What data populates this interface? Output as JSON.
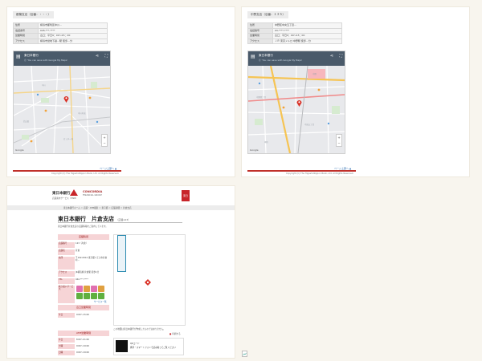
{
  "page1": {
    "header": "都築支店（店番：・・・）",
    "rows": [
      {
        "k": "住所",
        "v": "横浜市都筑区中川…"
      },
      {
        "k": "電話番号",
        "v": "045-***-****"
      },
      {
        "k": "営業時間",
        "v": "窓口：平日9：00～15：00"
      },
      {
        "k": "アクセス",
        "v": "横浜市営地下鉄…駅 徒歩…分"
      }
    ],
    "map_title": "東日本銀行",
    "map_sub": "Ⓒ 'You can save with Google My Maps'",
    "footer_link": "ページ上部へ ▲",
    "footer_copy": "Copyright (C) The Higashi-Nippon Bank, Ltd. All Rights Reserved."
  },
  "page2": {
    "header": "中野支店（店番：１３５）",
    "rows": [
      {
        "k": "住所",
        "v": "中野区中央五丁目…"
      },
      {
        "k": "電話番号",
        "v": "03-****-****"
      },
      {
        "k": "営業時間",
        "v": "窓口：平日9：00～15：00"
      },
      {
        "k": "アクセス",
        "v": "ＪＲ 東京メトロ 中野駅 徒歩…分"
      }
    ],
    "map_title": "東日本銀行",
    "map_sub": "Ⓒ 'You can save with Google My Maps'",
    "footer_link": "ページ上部へ ▲",
    "footer_copy": "Copyright (C) The Higashi-Nippon Bank, Ltd. All Rights Reserved."
  },
  "site": {
    "logo_text": "東日本銀行",
    "logo_sub": "店舗案内サービス（HNB）",
    "partner_logo": "CONCORDIA",
    "partner_sub": "FINANCIAL GROUP",
    "badge": "東日",
    "breadcrumb": "東日本銀行ホーム ＞ 店舗・ATM検索 ＞ 東京都 ＞ 店舗詳細 ＞ 片倉支店",
    "title": "東日本銀行　片倉支店",
    "title_code": "（店番123）",
    "intro": "東日本銀行片倉支店の店舗情報をご案内しています。",
    "info_head": "店舗情報",
    "info": [
      {
        "k": "店舗番号",
        "v": "123（片倉）"
      },
      {
        "k": "店舗名",
        "v": "片倉"
      },
      {
        "k": "住所",
        "v": "〒192-0914 東京都八王子市片倉町…"
      },
      {
        "k": "アクセス",
        "v": "JR横浜線 片倉駅 徒歩1分"
      },
      {
        "k": "TEL",
        "v": "042-***-****"
      }
    ],
    "services_label": "取り扱いサービス",
    "more_services": "サービス一覧",
    "hours_head": "窓口営業時間",
    "hours": [
      {
        "k": "平日",
        "v": "9:00～15:00"
      }
    ],
    "atm_head": "ATM営業時間",
    "atm": [
      {
        "k": "平日",
        "v": "8:00～21:00"
      },
      {
        "k": "土曜",
        "v": "9:00～19:00"
      },
      {
        "k": "日曜",
        "v": "9:00～19:00"
      }
    ],
    "map_note": "この地図は東日本銀行が作成したものではありません。",
    "print_label": "印刷する",
    "qr_label": "QRコード",
    "qr_desc": "携帯・スマートフォンで読み取ってご覧ください"
  },
  "colors": {
    "accent_red": "#c8252a",
    "pink": "#f6d4d6"
  }
}
